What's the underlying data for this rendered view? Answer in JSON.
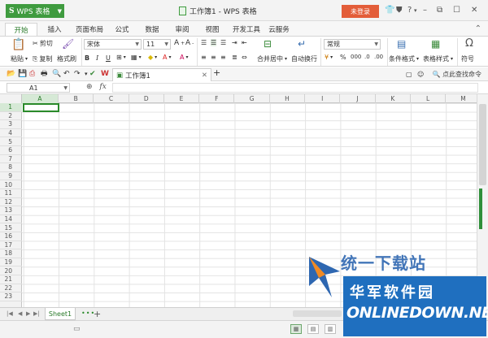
{
  "titlebar": {
    "app_label": "WPS 表格",
    "doc_title": "工作簿1 - WPS 表格",
    "login_label": "未登录",
    "right_icons": [
      "shirt-icon",
      "shield-icon",
      "help-icon",
      "minimize-icon",
      "restore-icon",
      "maximize-icon",
      "close-icon"
    ]
  },
  "menu": {
    "tabs": [
      "开始",
      "插入",
      "页面布局",
      "公式",
      "数据",
      "审阅",
      "视图",
      "开发工具",
      "云服务"
    ],
    "active": "开始"
  },
  "ribbon": {
    "paste": "粘贴",
    "cut": "剪切",
    "copy": "复制",
    "format_painter": "格式刷",
    "font_name": "宋体",
    "font_size": "11",
    "merge_center": "合并居中",
    "wrap_text": "自动换行",
    "number_format": "常规",
    "conditional_format": "条件格式",
    "table_style": "表格样式",
    "symbol": "符号"
  },
  "document_tab": {
    "label": "工作簿1"
  },
  "search_command": "点此查找命令",
  "formula_bar": {
    "cell_ref": "A1",
    "fx": "fx",
    "value": ""
  },
  "grid": {
    "columns": [
      "A",
      "B",
      "C",
      "D",
      "E",
      "F",
      "G",
      "H",
      "I",
      "J",
      "K",
      "L",
      "M"
    ],
    "rows": [
      "1",
      "2",
      "3",
      "4",
      "5",
      "6",
      "7",
      "8",
      "9",
      "10",
      "11",
      "12",
      "13",
      "14",
      "15",
      "16",
      "17",
      "18",
      "19",
      "20",
      "21",
      "22",
      "23"
    ],
    "selected_cell": "A1"
  },
  "sheets": {
    "tabs": [
      "Sheet1"
    ],
    "active": "Sheet1",
    "more": "•••",
    "add": "+"
  },
  "watermark": {
    "site_cn": "统一下载站",
    "brand_cn": "华军软件园",
    "brand_en": "ONLINEDOWN.NET",
    "colors": {
      "blue": "#1f6fbf",
      "orange": "#f08a24"
    }
  },
  "colors": {
    "accent_green": "#3f9b3f",
    "login_red": "#e35d39"
  }
}
